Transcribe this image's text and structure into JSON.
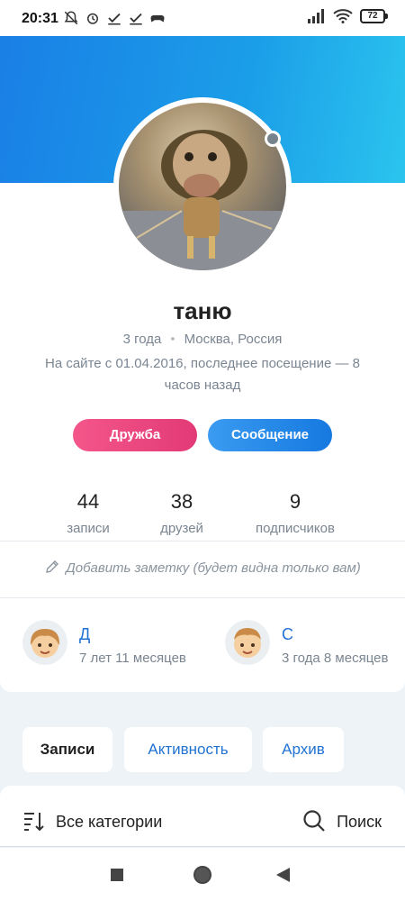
{
  "status_bar": {
    "time": "20:31",
    "battery": "72"
  },
  "profile": {
    "name": "таню",
    "age": "3 года",
    "location": "Москва, Россия",
    "last_seen": "На сайте с 01.04.2016, последнее посещение — 8 часов назад",
    "online_status": "offline"
  },
  "actions": {
    "friend_label": "Дружба",
    "message_label": "Сообщение"
  },
  "stats": [
    {
      "value": "44",
      "label": "записи"
    },
    {
      "value": "38",
      "label": "друзей"
    },
    {
      "value": "9",
      "label": "подписчиков"
    }
  ],
  "note": {
    "label": "Добавить заметку (будет видна только вам)"
  },
  "relatives": [
    {
      "name": "Д",
      "age": "7 лет 11 месяцев",
      "avatar": "girl-emoji"
    },
    {
      "name": "С",
      "age": "3 года 8 месяцев",
      "avatar": "boy-emoji"
    }
  ],
  "tabs": [
    {
      "label": "Записи",
      "active": true
    },
    {
      "label": "Активность",
      "active": false
    },
    {
      "label": "Архив",
      "active": false
    }
  ],
  "filter": {
    "categories_label": "Все категории",
    "search_label": "Поиск"
  },
  "colors": {
    "accent": "#2272d3",
    "friend_button": "#e23a76",
    "message_button": "#1679e0",
    "cover": "#1a7fe6"
  }
}
